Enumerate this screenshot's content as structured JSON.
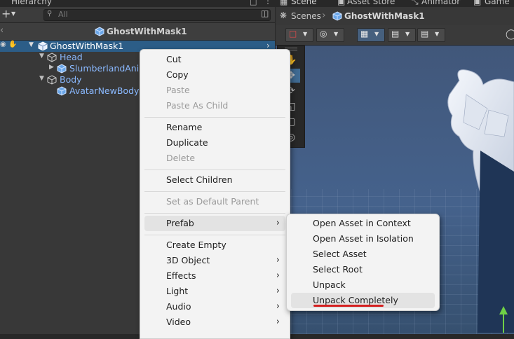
{
  "hierarchy": {
    "tab_label": "Hierarchy",
    "add_label": "+",
    "search_placeholder": "All",
    "breadcrumb_title": "GhostWithMask1",
    "rows": [
      {
        "label": "GhostWithMask1"
      },
      {
        "label": "Head"
      },
      {
        "label": "SlumberlandAnim"
      },
      {
        "label": "Body"
      },
      {
        "label": "AvatarNewBody"
      }
    ]
  },
  "scene": {
    "tabs": [
      "Scene",
      "Asset Store",
      "Animator",
      "Game"
    ],
    "breadcrumb_root": "Scenes",
    "breadcrumb_current": "GhostWithMask1"
  },
  "context_menu": {
    "items": [
      {
        "label": "Cut"
      },
      {
        "label": "Copy"
      },
      {
        "label": "Paste"
      },
      {
        "label": "Paste As Child"
      },
      {
        "label": "Rename"
      },
      {
        "label": "Duplicate"
      },
      {
        "label": "Delete"
      },
      {
        "label": "Select Children"
      },
      {
        "label": "Set as Default Parent"
      },
      {
        "label": "Prefab"
      },
      {
        "label": "Create Empty"
      },
      {
        "label": "3D Object"
      },
      {
        "label": "Effects"
      },
      {
        "label": "Light"
      },
      {
        "label": "Audio"
      },
      {
        "label": "Video"
      }
    ]
  },
  "prefab_submenu": {
    "items": [
      {
        "label": "Open Asset in Context"
      },
      {
        "label": "Open Asset in Isolation"
      },
      {
        "label": "Select Asset"
      },
      {
        "label": "Select Root"
      },
      {
        "label": "Unpack"
      },
      {
        "label": "Unpack Completely"
      }
    ]
  },
  "colors": {
    "selection": "#2c5d87",
    "prefab_text": "#8ab9ff",
    "annotation_underline": "#d42020"
  }
}
